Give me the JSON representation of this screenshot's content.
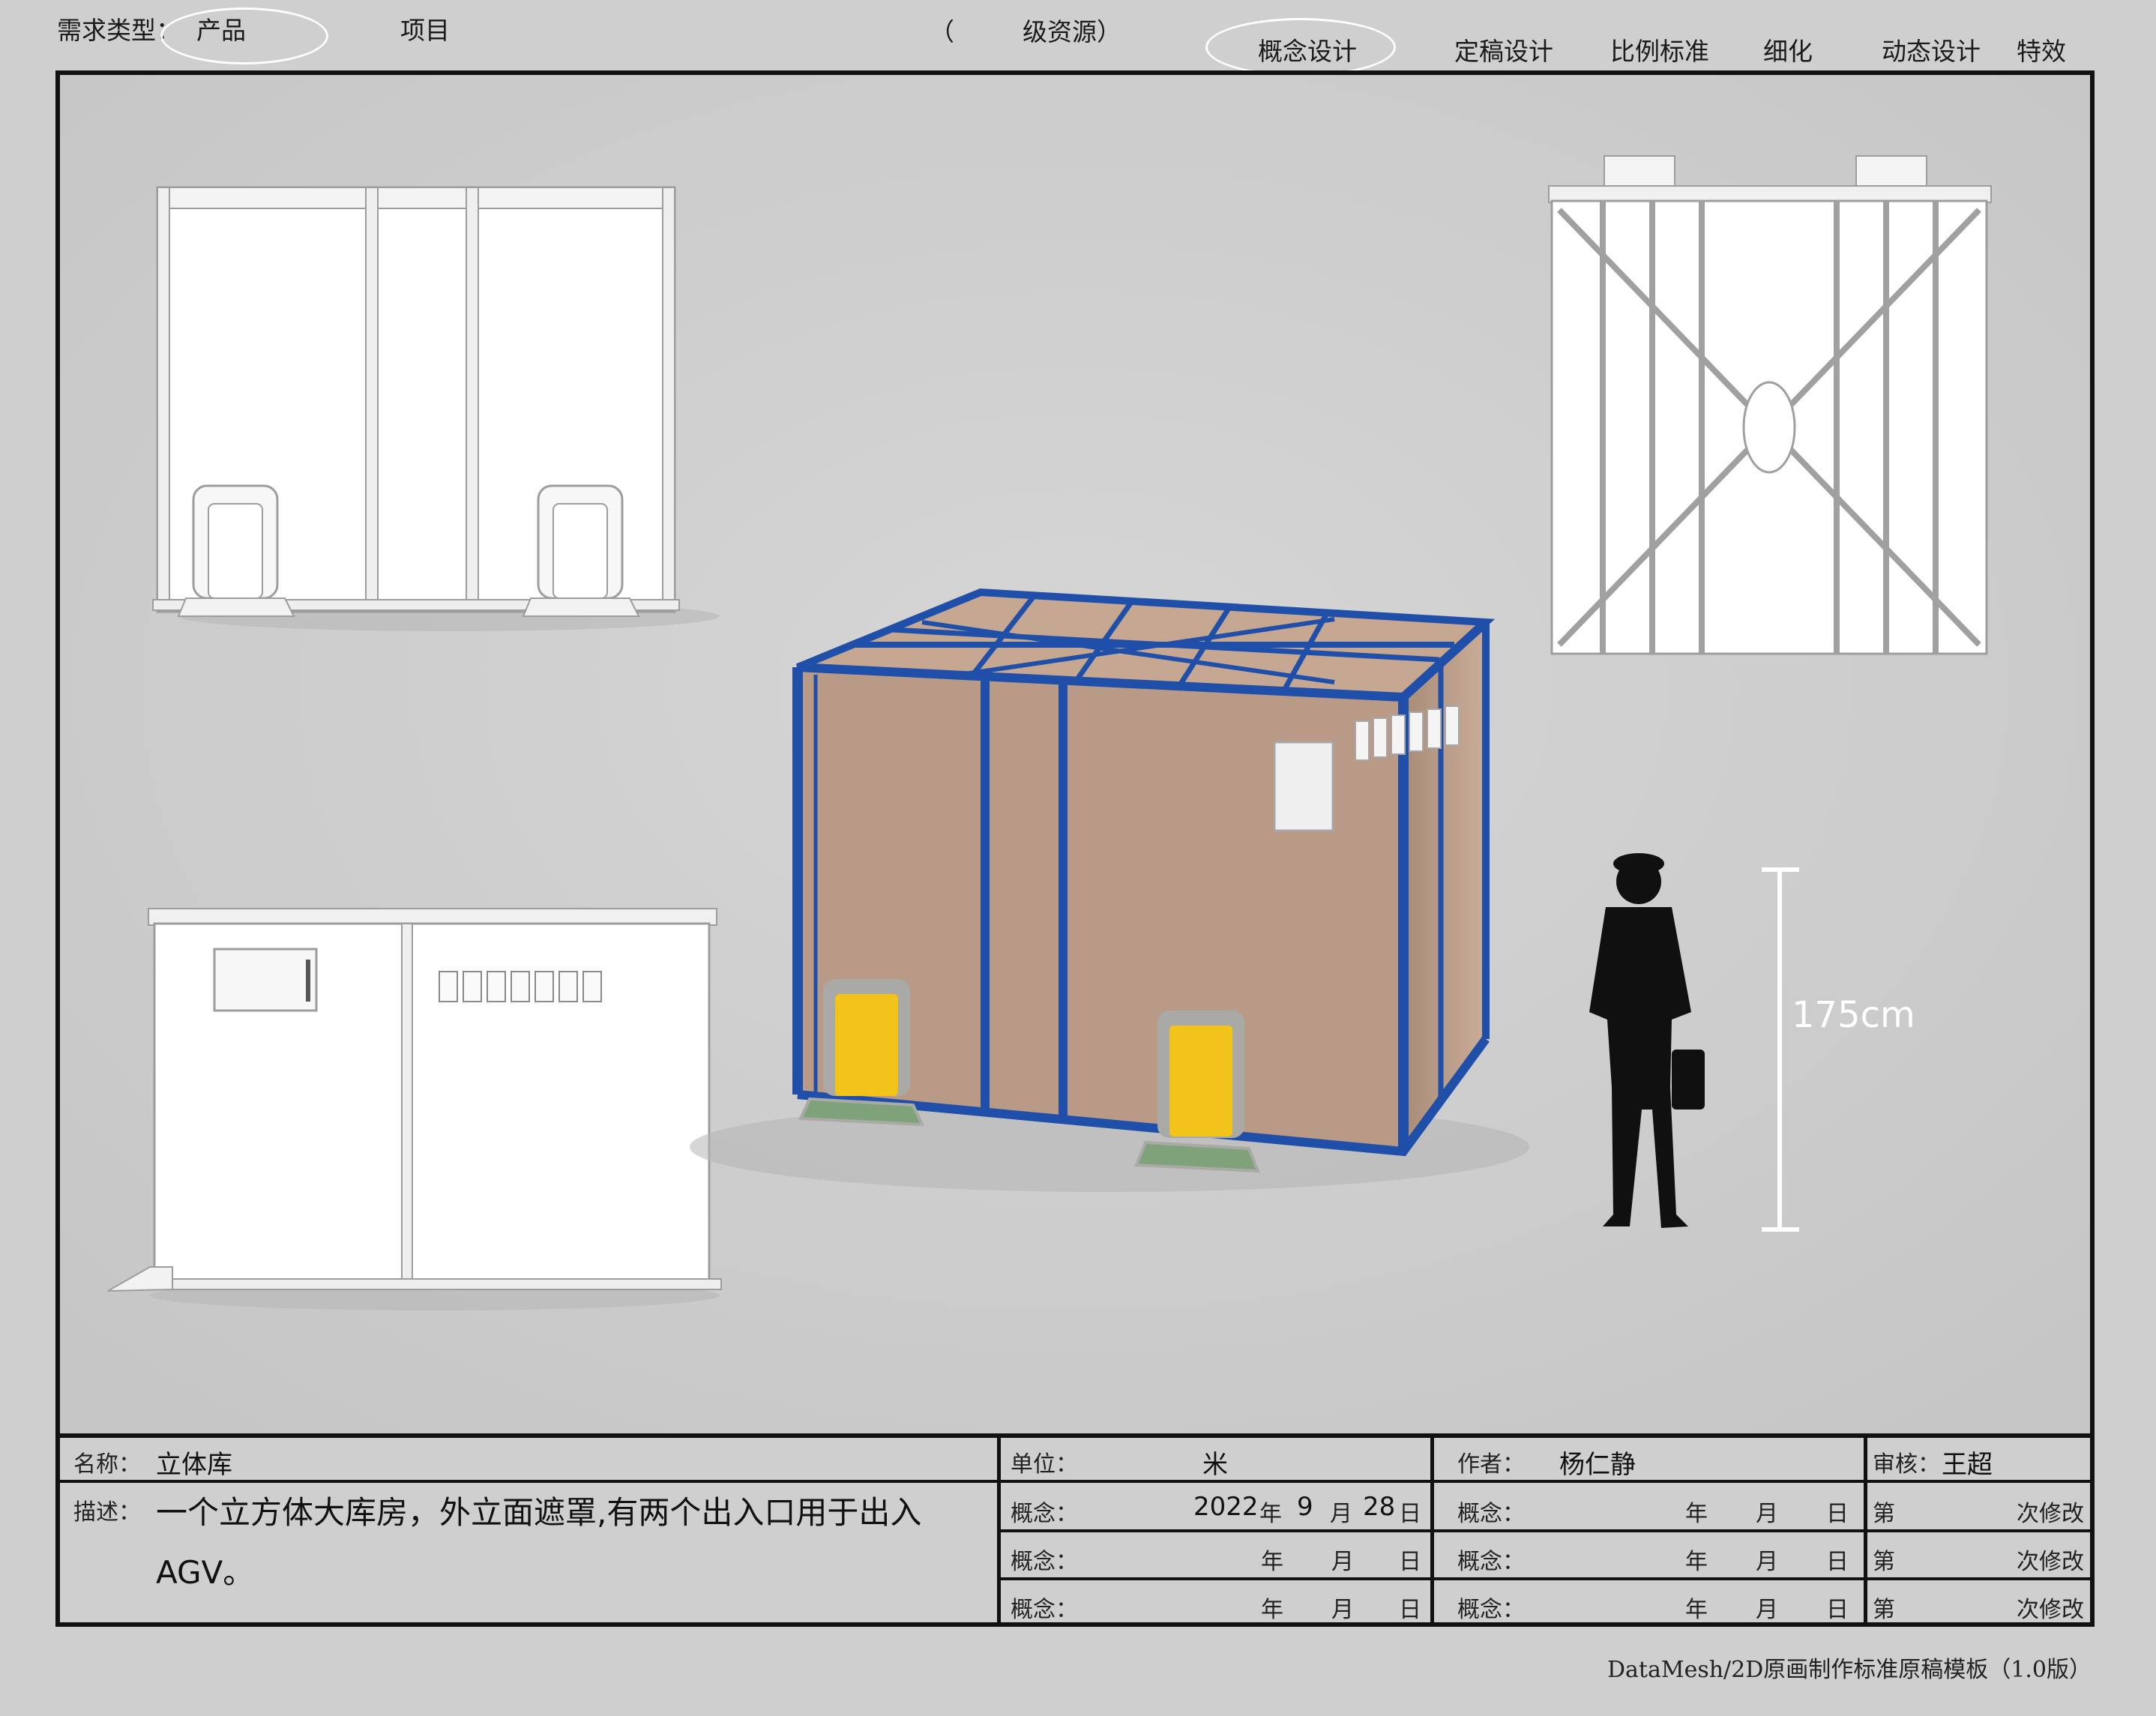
{
  "header": {
    "req_type_label": "需求类型：",
    "req_type_value": "产品",
    "project_label": "项目",
    "paren_open": "（",
    "resource_label": "级资源）",
    "stages": [
      "概念设计",
      "定稿设计",
      "比例标准",
      "细化",
      "动态设计",
      "特效"
    ]
  },
  "drawing": {
    "height_label": "175cm",
    "colors": {
      "frame_blue": "#1f4fa8",
      "panel": "#b89a86",
      "door": "#f2c318",
      "door_frame": "#a9aaa5",
      "ramp": "#7fa27a"
    }
  },
  "table": {
    "name_label": "名称：",
    "name_value": "立体库",
    "desc_label": "描述：",
    "desc_value": "一个立方体大库房，外立面遮罩,有两个出入口用于出入AGV。",
    "unit_label": "单位：",
    "unit_value": "米",
    "author_label": "作者：",
    "author_value": "杨仁静",
    "review_label": "审核：",
    "review_value": "王超",
    "concept_label": "概念：",
    "date1": {
      "year": "2022",
      "month": "9",
      "day": "28"
    },
    "year_char": "年",
    "month_char": "月",
    "day_char": "日",
    "rev_prefix": "第",
    "rev_suffix": "次修改"
  },
  "footer": "DataMesh/2D原画制作标准原稿模板（1.0版）"
}
